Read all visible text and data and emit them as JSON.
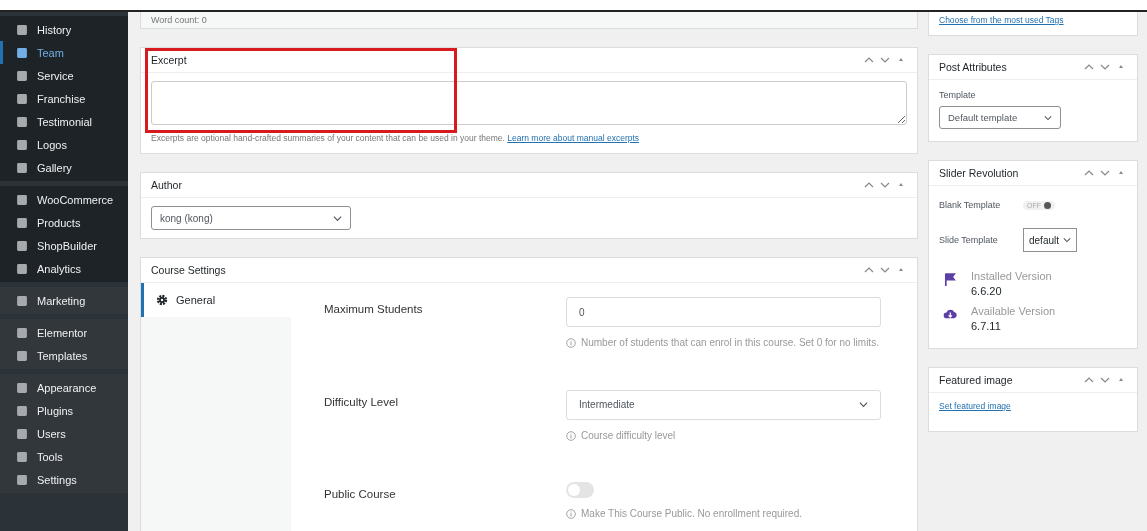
{
  "sidebar": {
    "groups": [
      {
        "open": true,
        "items": [
          {
            "label": "History",
            "selected": false
          },
          {
            "label": "Team",
            "selected": true
          },
          {
            "label": "Service",
            "selected": false
          },
          {
            "label": "Franchise",
            "selected": false
          },
          {
            "label": "Testimonial",
            "selected": false
          },
          {
            "label": "Logos",
            "selected": false
          },
          {
            "label": "Gallery",
            "selected": false
          }
        ]
      },
      {
        "open": true,
        "items": [
          {
            "label": "WooCommerce",
            "selected": false
          },
          {
            "label": "Products",
            "selected": false
          },
          {
            "label": "ShopBuilder",
            "selected": false
          },
          {
            "label": "Analytics",
            "selected": false
          }
        ]
      },
      {
        "open": false,
        "items": [
          {
            "label": "Marketing",
            "selected": false
          }
        ]
      },
      {
        "open": false,
        "items": [
          {
            "label": "Elementor",
            "selected": false
          },
          {
            "label": "Templates",
            "selected": false
          }
        ]
      },
      {
        "open": false,
        "items": [
          {
            "label": "Appearance",
            "selected": false
          },
          {
            "label": "Plugins",
            "selected": false
          },
          {
            "label": "Users",
            "selected": false
          },
          {
            "label": "Tools",
            "selected": false
          },
          {
            "label": "Settings",
            "selected": false
          }
        ]
      }
    ]
  },
  "word_count": "Word count: 0",
  "excerpt": {
    "title": "Excerpt",
    "highlighted": true,
    "help": "Excerpts are optional hand-crafted summaries of your content that can be used in your theme.",
    "link": "Learn more about manual excerpts"
  },
  "author": {
    "title": "Author",
    "value": "kong (kong)"
  },
  "course_settings": {
    "title": "Course Settings",
    "tabs": [
      {
        "label": "General",
        "selected": true
      }
    ],
    "fields": [
      {
        "kind": "number",
        "label": "Maximum Students",
        "value": "0",
        "help": "Number of students that can enrol in this course. Set 0 for no limits."
      },
      {
        "kind": "select",
        "label": "Difficulty Level",
        "value": "Intermediate",
        "help": "Course difficulty level"
      },
      {
        "kind": "toggle",
        "label": "Public Course",
        "on": false,
        "help": "Make This Course Public. No enrollment required."
      }
    ]
  },
  "tags": {
    "link": "Choose from the most used Tags"
  },
  "post_attributes": {
    "title": "Post Attributes",
    "label": "Template",
    "value": "Default template"
  },
  "slider_revolution": {
    "title": "Slider Revolution",
    "blank_label": "Blank Template",
    "blank_toggle": {
      "text": "OFF",
      "on": false
    },
    "slide_label": "Slide Template",
    "slide_value": "default",
    "versions": [
      {
        "kind": "installed",
        "label": "Installed Version",
        "value": "6.6.20"
      },
      {
        "kind": "available",
        "label": "Available Version",
        "value": "6.7.11"
      }
    ]
  },
  "featured_image": {
    "title": "Featured image",
    "link": "Set featured image"
  }
}
